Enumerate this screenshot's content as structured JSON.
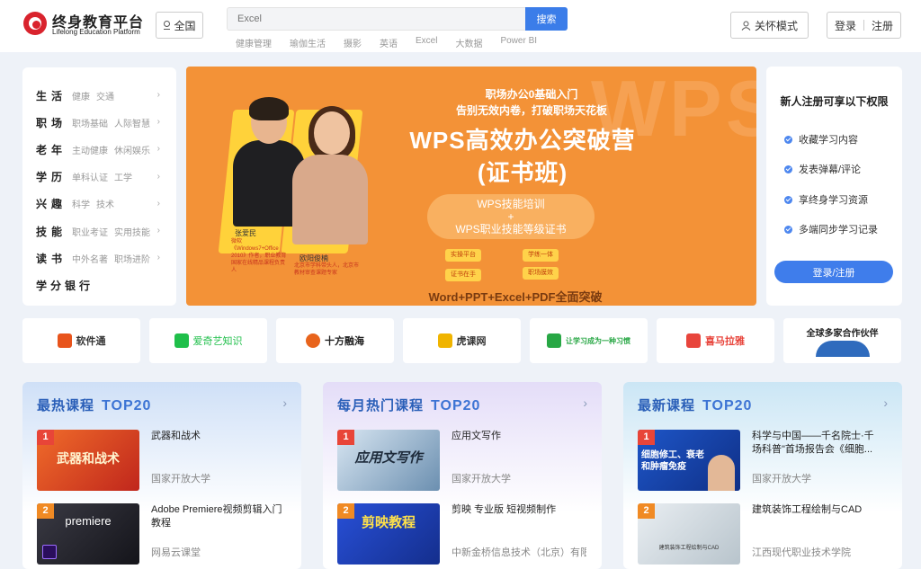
{
  "header": {
    "logo_title": "终身教育平台",
    "logo_subtitle": "Lifelong Education Platform",
    "region_label": "全国",
    "search_placeholder": "Excel",
    "search_button": "搜索",
    "hot_keywords": [
      "健康管理",
      "瑜伽生活",
      "摄影",
      "英语",
      "Excel",
      "大数据",
      "Power BI"
    ],
    "care_mode": "关怀模式",
    "login": "登录",
    "register": "注册"
  },
  "categories": [
    {
      "title": "生活",
      "subs": [
        "健康",
        "交通"
      ]
    },
    {
      "title": "职场",
      "subs": [
        "职场基础",
        "人际智慧"
      ]
    },
    {
      "title": "老年",
      "subs": [
        "主动健康",
        "休闲娱乐"
      ]
    },
    {
      "title": "学历",
      "subs": [
        "单科认证",
        "工学"
      ]
    },
    {
      "title": "兴趣",
      "subs": [
        "科学",
        "技术"
      ]
    },
    {
      "title": "技能",
      "subs": [
        "职业考证",
        "实用技能"
      ]
    },
    {
      "title": "读书",
      "subs": [
        "中外名著",
        "职场进阶"
      ]
    },
    {
      "title": "学分银行",
      "subs": []
    }
  ],
  "banner": {
    "bg_word": "WPS",
    "subtitle_line1": "职场办公0基础入门",
    "subtitle_line2": "告别无效内卷，打破职场天花板",
    "title_line1": "WPS高效办公突破营",
    "title_line2": "(证书班)",
    "pill_line1": "WPS技能培训",
    "pill_plus": "+",
    "pill_line2": "WPS职业技能等级证书",
    "tags": [
      "实操平台",
      "学练一体",
      "证书在手",
      "职场膜效"
    ],
    "footer": "Word+PPT+Excel+PDF全面突破",
    "teacher1_name": "张爱民",
    "teacher1_desc": "微软《Windows7+Office 2010》作者，职业教育国家在线精品课程负责人",
    "teacher2_name": "欧阳俊楠",
    "teacher2_desc": "北京市学科带头人，北京市教材审查课题专家"
  },
  "register_panel": {
    "title": "新人注册可享以下权限",
    "perks": [
      "收藏学习内容",
      "发表弹幕/评论",
      "享终身学习资源",
      "多端同步学习记录"
    ],
    "button": "登录/注册"
  },
  "partners": [
    {
      "name": "软件通",
      "color": "#e8541c"
    },
    {
      "name": "爱奇艺知识",
      "color": "#1fbf4a"
    },
    {
      "name": "十方融海",
      "color": "#e8641c"
    },
    {
      "name": "虎课网",
      "color": "#f0b400"
    },
    {
      "name": "让学习成为一种习惯",
      "color": "#28a745"
    },
    {
      "name": "喜马拉雅",
      "color": "#e8453c"
    },
    {
      "name": "全球多家合作伙伴",
      "color": "#2a5fb8"
    }
  ],
  "panels": [
    {
      "title": "最热课程",
      "top": "TOP20",
      "items": [
        {
          "rank": "1",
          "title": "武器和战术",
          "org": "国家开放大学",
          "thumb_text": "武器和战术"
        },
        {
          "rank": "2",
          "title": "Adobe Premiere视频剪辑入门教程",
          "org": "网易云课堂",
          "thumb_text": "premiere"
        }
      ]
    },
    {
      "title": "每月热门课程",
      "top": "TOP20",
      "items": [
        {
          "rank": "1",
          "title": "应用文写作",
          "org": "国家开放大学",
          "thumb_text": "应用文写作"
        },
        {
          "rank": "2",
          "title": "剪映 专业版 短视频制作",
          "org": "中新金桥信息技术（北京）有限公司",
          "thumb_text": "剪映教程"
        }
      ]
    },
    {
      "title": "最新课程",
      "top": "TOP20",
      "items": [
        {
          "rank": "1",
          "title": "科学与中国——千名院士·千场科普\"首场报告会《细胞...",
          "org": "国家开放大学",
          "thumb_text": "细胞修工、衰老和肿瘤免疫"
        },
        {
          "rank": "2",
          "title": "建筑装饰工程绘制与CAD",
          "org": "江西现代职业技术学院",
          "thumb_text": "建筑装饰工程绘制与CAD"
        }
      ]
    }
  ]
}
